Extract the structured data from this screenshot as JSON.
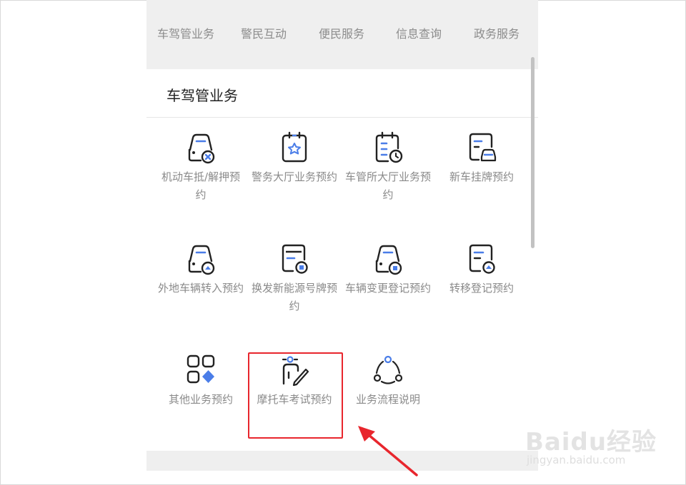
{
  "tabs": [
    "车驾管业务",
    "警民互动",
    "便民服务",
    "信息查询",
    "政务服务"
  ],
  "section_title": "车驾管业务",
  "services": [
    {
      "label": "机动车抵/解押预约",
      "icon": "car-cancel-icon"
    },
    {
      "label": "警务大厅业务预约",
      "icon": "clipboard-star-icon"
    },
    {
      "label": "车管所大厅业务预约",
      "icon": "calendar-clock-icon"
    },
    {
      "label": "新车挂牌预约",
      "icon": "document-car-icon"
    },
    {
      "label": "外地车辆转入预约",
      "icon": "car-transfer-icon"
    },
    {
      "label": "换发新能源号牌预约",
      "icon": "document-energy-icon"
    },
    {
      "label": "车辆变更登记预约",
      "icon": "car-change-icon"
    },
    {
      "label": "转移登记预约",
      "icon": "document-transfer-icon"
    },
    {
      "label": "其他业务预约",
      "icon": "grid-apps-icon"
    },
    {
      "label": "摩托车考试预约",
      "icon": "person-pen-icon"
    },
    {
      "label": "业务流程说明",
      "icon": "process-cycle-icon"
    }
  ],
  "watermark": {
    "logo": "Baidu经验",
    "url": "jingyan.baidu.com"
  },
  "colors": {
    "accent": "#4a7de8",
    "highlight": "#e8262d",
    "nav_bg": "#efefef"
  }
}
